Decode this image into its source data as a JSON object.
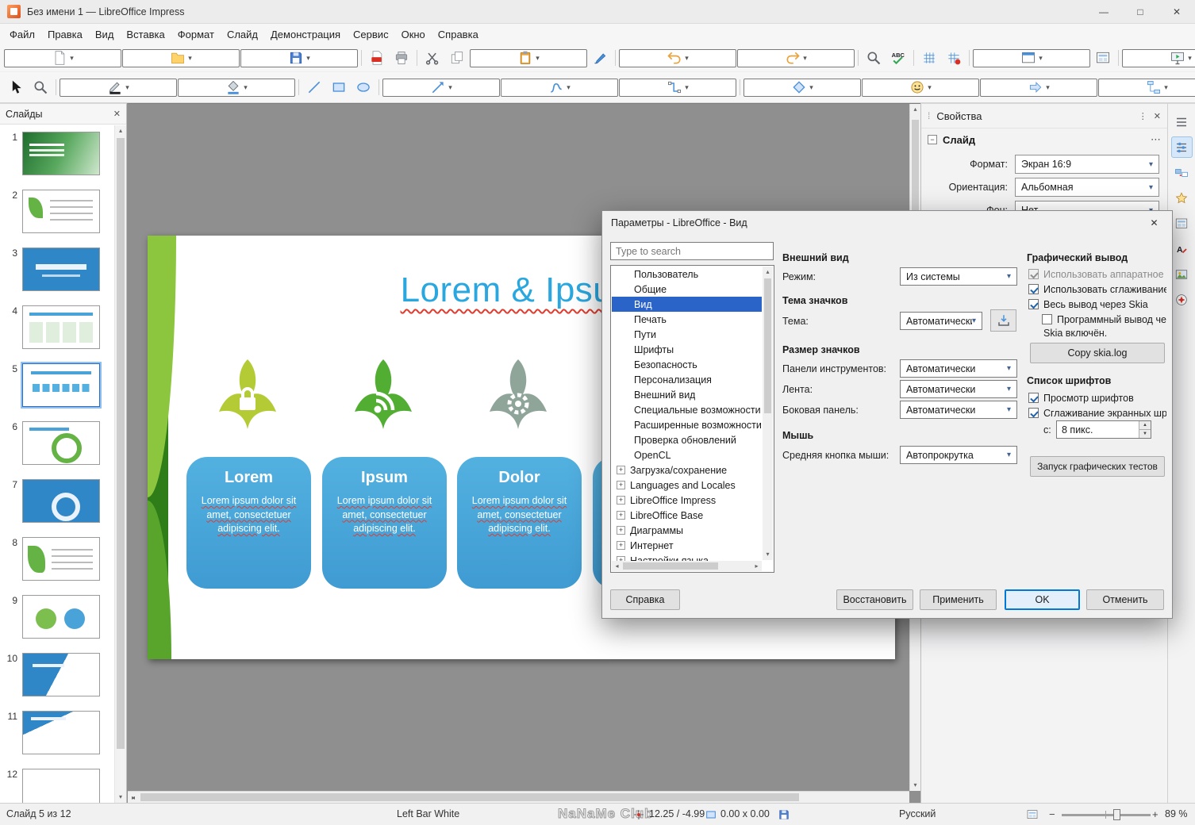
{
  "window": {
    "title": "Без имени 1 — LibreOffice Impress"
  },
  "menubar": {
    "items": [
      "Файл",
      "Правка",
      "Вид",
      "Вставка",
      "Формат",
      "Слайд",
      "Демонстрация",
      "Сервис",
      "Окно",
      "Справка"
    ]
  },
  "toolbar_standard": {
    "items": [
      {
        "name": "new-document-button",
        "sym": "#sym-doc",
        "cls": "dd"
      },
      {
        "name": "open-button",
        "sym": "#sym-folder",
        "cls": "dd"
      },
      {
        "name": "save-button",
        "sym": "#sym-floppy",
        "cls": "dd"
      },
      {
        "name": "separator",
        "cls": "sep",
        "inter": "false"
      },
      {
        "name": "export-pdf-button",
        "sym": "#sym-pdf"
      },
      {
        "name": "print-button",
        "sym": "#sym-printer"
      },
      {
        "name": "separator",
        "cls": "sep",
        "inter": "false"
      },
      {
        "name": "cut-button",
        "sym": "#sym-scissors"
      },
      {
        "name": "copy-button",
        "sym": "#sym-copy"
      },
      {
        "name": "paste-button",
        "sym": "#sym-clipboard",
        "cls": "dd"
      },
      {
        "name": "clone-formatting-button",
        "sym": "#sym-brush"
      },
      {
        "name": "separator",
        "cls": "sep",
        "inter": "false"
      },
      {
        "name": "undo-button",
        "sym": "#sym-undo",
        "cls": "dd"
      },
      {
        "name": "redo-button",
        "sym": "#sym-redo",
        "cls": "dd"
      },
      {
        "name": "separator",
        "cls": "sep",
        "inter": "false"
      },
      {
        "name": "find-replace-button",
        "sym": "#sym-search"
      },
      {
        "name": "spelling-button",
        "sym": "#sym-spell"
      },
      {
        "name": "separator",
        "cls": "sep",
        "inter": "false"
      },
      {
        "name": "display-grid-button",
        "sym": "#sym-grid"
      },
      {
        "name": "snap-to-grid-button",
        "sym": "#sym-snapgrid"
      },
      {
        "name": "separator",
        "cls": "sep",
        "inter": "false"
      },
      {
        "name": "display-views-button",
        "sym": "#sym-window",
        "cls": "dd"
      },
      {
        "name": "master-slide-button",
        "sym": "#sym-layout"
      },
      {
        "name": "separator",
        "cls": "sep",
        "inter": "false"
      },
      {
        "name": "start-from-first-slide-button",
        "sym": "#sym-screenplay",
        "cls": "dd"
      },
      {
        "name": "start-from-current-slide-button",
        "sym": "#sym-screenplay"
      },
      {
        "name": "separator",
        "cls": "sep",
        "inter": "false"
      },
      {
        "name": "insert-table-button",
        "sym": "#sym-table",
        "cls": "dd"
      },
      {
        "name": "insert-image-button",
        "sym": "#sym-image"
      },
      {
        "name": "insert-chart-button",
        "sym": "#sym-chart"
      },
      {
        "name": "insert-text-box-button",
        "sym": "#sym-textbox"
      },
      {
        "name": "separator",
        "cls": "sep",
        "inter": "false"
      },
      {
        "name": "insert-special-character-button",
        "sym": "#sym-omega",
        "cls": "dd"
      },
      {
        "name": "insert-fontwork-button",
        "sym": "#sym-fontwork"
      },
      {
        "name": "insert-hyperlink-button",
        "sym": "#sym-globe"
      },
      {
        "name": "show-draw-functions-button",
        "sym": "#sym-pencil",
        "cls": "active"
      },
      {
        "name": "separator",
        "cls": "sep",
        "inter": "false"
      },
      {
        "name": "new-slide-button",
        "sym": "#sym-slideplus",
        "cls": "dd"
      },
      {
        "name": "duplicate-slide-button",
        "sym": "#sym-copy"
      },
      {
        "name": "delete-slide-button",
        "sym": "#sym-slidedel"
      },
      {
        "name": "slide-properties-button",
        "sym": "#sym-layout",
        "cls": "dd"
      }
    ]
  },
  "toolbar_drawing": {
    "items": [
      {
        "name": "select-button",
        "sym": "#sym-cursor"
      },
      {
        "name": "zoom-button",
        "sym": "#sym-search"
      },
      {
        "name": "separator",
        "cls": "sep",
        "inter": "false"
      },
      {
        "name": "line-color-button",
        "sym": "#sym-linecolor",
        "cls": "dd"
      },
      {
        "name": "fill-color-button",
        "sym": "#sym-fillcolor",
        "cls": "dd"
      },
      {
        "name": "separator",
        "cls": "sep",
        "inter": "false"
      },
      {
        "name": "insert-line-button",
        "sym": "#sym-line"
      },
      {
        "name": "rectangle-button",
        "sym": "#sym-rect"
      },
      {
        "name": "ellipse-button",
        "sym": "#sym-ellipse"
      },
      {
        "name": "separator",
        "cls": "sep",
        "inter": "false"
      },
      {
        "name": "lines-and-arrows-button",
        "sym": "#sym-arrowline",
        "cls": "dd"
      },
      {
        "name": "curves-and-polygons-button",
        "sym": "#sym-curve",
        "cls": "dd"
      },
      {
        "name": "connectors-button",
        "sym": "#sym-connector",
        "cls": "dd"
      },
      {
        "name": "separator",
        "cls": "sep",
        "inter": "false"
      },
      {
        "name": "basic-shapes-button",
        "sym": "#sym-diamond",
        "cls": "dd"
      },
      {
        "name": "symbol-shapes-button",
        "sym": "#sym-smiley",
        "cls": "dd"
      },
      {
        "name": "block-arrows-button",
        "sym": "#sym-blockarrow",
        "cls": "dd"
      },
      {
        "name": "flowchart-button",
        "sym": "#sym-flowchart",
        "cls": "dd"
      },
      {
        "name": "callout-shapes-button",
        "sym": "#sym-callout",
        "cls": "dd"
      },
      {
        "name": "stars-and-banners-button",
        "sym": "#sym-star",
        "cls": "dd"
      },
      {
        "name": "3d-objects-button",
        "sym": "#sym-cube",
        "cls": "dd"
      },
      {
        "name": "separator",
        "cls": "sep",
        "inter": "false"
      },
      {
        "name": "rotate-button",
        "sym": "#sym-rotate"
      },
      {
        "name": "align-objects-button",
        "sym": "#sym-align",
        "cls": "dd"
      },
      {
        "name": "arrange-button",
        "sym": "#sym-arrange",
        "cls": "dd"
      },
      {
        "name": "distribute-button",
        "sym": "#sym-distrib",
        "cls": "dd"
      },
      {
        "name": "separator",
        "cls": "sep",
        "inter": "false"
      },
      {
        "name": "shadow-button",
        "sym": "#sym-shadow"
      },
      {
        "name": "crop-button",
        "sym": "#sym-crop"
      },
      {
        "name": "filter-button",
        "sym": "#sym-filter",
        "cls": "dd"
      },
      {
        "name": "separator",
        "cls": "sep",
        "inter": "false"
      },
      {
        "name": "points-button",
        "sym": "#sym-points"
      },
      {
        "name": "glue-points-button",
        "sym": "#sym-glue"
      },
      {
        "name": "toggle-extrusion-button",
        "sym": "#sym-cube"
      }
    ]
  },
  "slides_panel": {
    "title": "Слайды",
    "slides": [
      {
        "num": "1",
        "style": "t1"
      },
      {
        "num": "2",
        "style": "t2"
      },
      {
        "num": "3",
        "style": "t3"
      },
      {
        "num": "4",
        "style": "t4"
      },
      {
        "num": "5",
        "style": "t5 cur"
      },
      {
        "num": "6",
        "style": "t6"
      },
      {
        "num": "7",
        "style": "t7"
      },
      {
        "num": "8",
        "style": "t8"
      },
      {
        "num": "9",
        "style": "t9"
      },
      {
        "num": "10",
        "style": "t10"
      },
      {
        "num": "11",
        "style": "t11"
      },
      {
        "num": "12",
        "style": "t12"
      }
    ]
  },
  "canvas": {
    "title": "Lorem & Ipsum",
    "cards": [
      {
        "title": "Lorem",
        "body": "Lorem ipsum dolor sit amet, consectetuer adipiscing elit."
      },
      {
        "title": "Ipsum",
        "body": "Lorem ipsum dolor sit amet, consectetuer adipiscing elit."
      },
      {
        "title": "Dolor",
        "body": "Lorem ipsum dolor sit amet, consectetuer adipiscing elit."
      },
      {
        "title": "",
        "body": ""
      }
    ]
  },
  "sidebar": {
    "title": "Свойства",
    "section": "Слайд",
    "rows": [
      {
        "label": "Формат:",
        "value": "Экран 16:9"
      },
      {
        "label": "Ориентация:",
        "value": "Альбомная"
      },
      {
        "label": "Фон:",
        "value": "Нет"
      }
    ],
    "tabs": [
      {
        "name": "sidebar-settings-icon",
        "sym": "#sym-burger"
      },
      {
        "name": "properties-tab",
        "sym": "#sym-sliders",
        "cls": "active"
      },
      {
        "name": "slide-transition-tab",
        "sym": "#sym-transition"
      },
      {
        "name": "animation-tab",
        "sym": "#sym-star"
      },
      {
        "name": "master-slides-tab",
        "sym": "#sym-layout"
      },
      {
        "name": "styles-tab",
        "sym": "#sym-styles"
      },
      {
        "name": "gallery-tab",
        "sym": "#sym-image"
      },
      {
        "name": "navigator-tab",
        "sym": "#sym-navigator"
      }
    ]
  },
  "dialog": {
    "title": "Параметры - LibreOffice - Вид",
    "search_placeholder": "Type to search",
    "tree": [
      {
        "label": "Пользователь",
        "cls": "lvl1"
      },
      {
        "label": "Общие",
        "cls": "lvl1"
      },
      {
        "label": "Вид",
        "cls": "lvl1 sel"
      },
      {
        "label": "Печать",
        "cls": "lvl1"
      },
      {
        "label": "Пути",
        "cls": "lvl1"
      },
      {
        "label": "Шрифты",
        "cls": "lvl1"
      },
      {
        "label": "Безопасность",
        "cls": "lvl1"
      },
      {
        "label": "Персонализация",
        "cls": "lvl1"
      },
      {
        "label": "Внешний вид",
        "cls": "lvl1"
      },
      {
        "label": "Специальные возможности",
        "cls": "lvl1"
      },
      {
        "label": "Расширенные возможности",
        "cls": "lvl1"
      },
      {
        "label": "Проверка обновлений",
        "cls": "lvl1"
      },
      {
        "label": "OpenCL",
        "cls": "lvl1"
      },
      {
        "label": "Загрузка/сохранение",
        "exp": "+",
        "cls": "lvl0"
      },
      {
        "label": "Languages and Locales",
        "exp": "+",
        "cls": "lvl0"
      },
      {
        "label": "LibreOffice Impress",
        "exp": "+",
        "cls": "lvl0"
      },
      {
        "label": "LibreOffice Base",
        "exp": "+",
        "cls": "lvl0"
      },
      {
        "label": "Диаграммы",
        "exp": "+",
        "cls": "lvl0"
      },
      {
        "label": "Интернет",
        "exp": "+",
        "cls": "lvl0"
      },
      {
        "label": "Настройки языка",
        "exp": "+",
        "cls": "lvl0"
      }
    ],
    "appearance": {
      "title": "Внешний вид",
      "label": "Режим:",
      "value": "Из системы"
    },
    "icon_theme": {
      "title": "Тема значков",
      "label": "Тема:",
      "value": "Автоматически"
    },
    "icon_size": {
      "title": "Размер значков",
      "rows": [
        {
          "label": "Панели инструментов:",
          "value": "Автоматически"
        },
        {
          "label": "Лента:",
          "value": "Автоматически"
        },
        {
          "label": "Боковая панель:",
          "value": "Автоматически"
        }
      ]
    },
    "mouse": {
      "title": "Мышь",
      "label": "Средняя кнопка мыши:",
      "value": "Автопрокрутка"
    },
    "graphics": {
      "title": "Графический вывод",
      "checks": [
        {
          "label": "Использовать аппаратное ускорение",
          "cls": "checked disabled"
        },
        {
          "label": "Использовать сглаживание",
          "cls": "checked"
        },
        {
          "label": "Весь вывод через Skia",
          "cls": "checked"
        },
        {
          "label": "Программный вывод через Skia",
          "cls": "indent"
        }
      ],
      "status": "Skia включён.",
      "copy_button": "Copy skia.log"
    },
    "font_lists": {
      "title": "Список шрифтов",
      "checks": [
        {
          "label": "Просмотр шрифтов",
          "cls": "checked"
        },
        {
          "label": "Сглаживание экранных шрифтов",
          "cls": "checked"
        }
      ],
      "from_label": "с:",
      "from_value": "8 пикс.",
      "test_button": "Запуск графических тестов"
    },
    "buttons": {
      "help": "Справка",
      "reset": "Восстановить",
      "apply": "Применить",
      "ok": "OK",
      "cancel": "Отменить"
    }
  },
  "statusbar": {
    "slide": "Слайд 5 из 12",
    "master": "Left Bar White",
    "watermark": "NaNaMe Club",
    "position": "12.25 / -4.99",
    "size": "0.00 x 0.00",
    "language": "Русский",
    "zoom": "89 %"
  },
  "colors": {
    "accent": "#0078d7",
    "selection_blue": "#2a64c8",
    "card_blue": "#46a4d7",
    "slide_title_blue": "#2aa7de",
    "leaf_yellow_green": "#b4cb36",
    "leaf_green": "#52ae32",
    "leaf_gray_green": "#8fa59a"
  }
}
